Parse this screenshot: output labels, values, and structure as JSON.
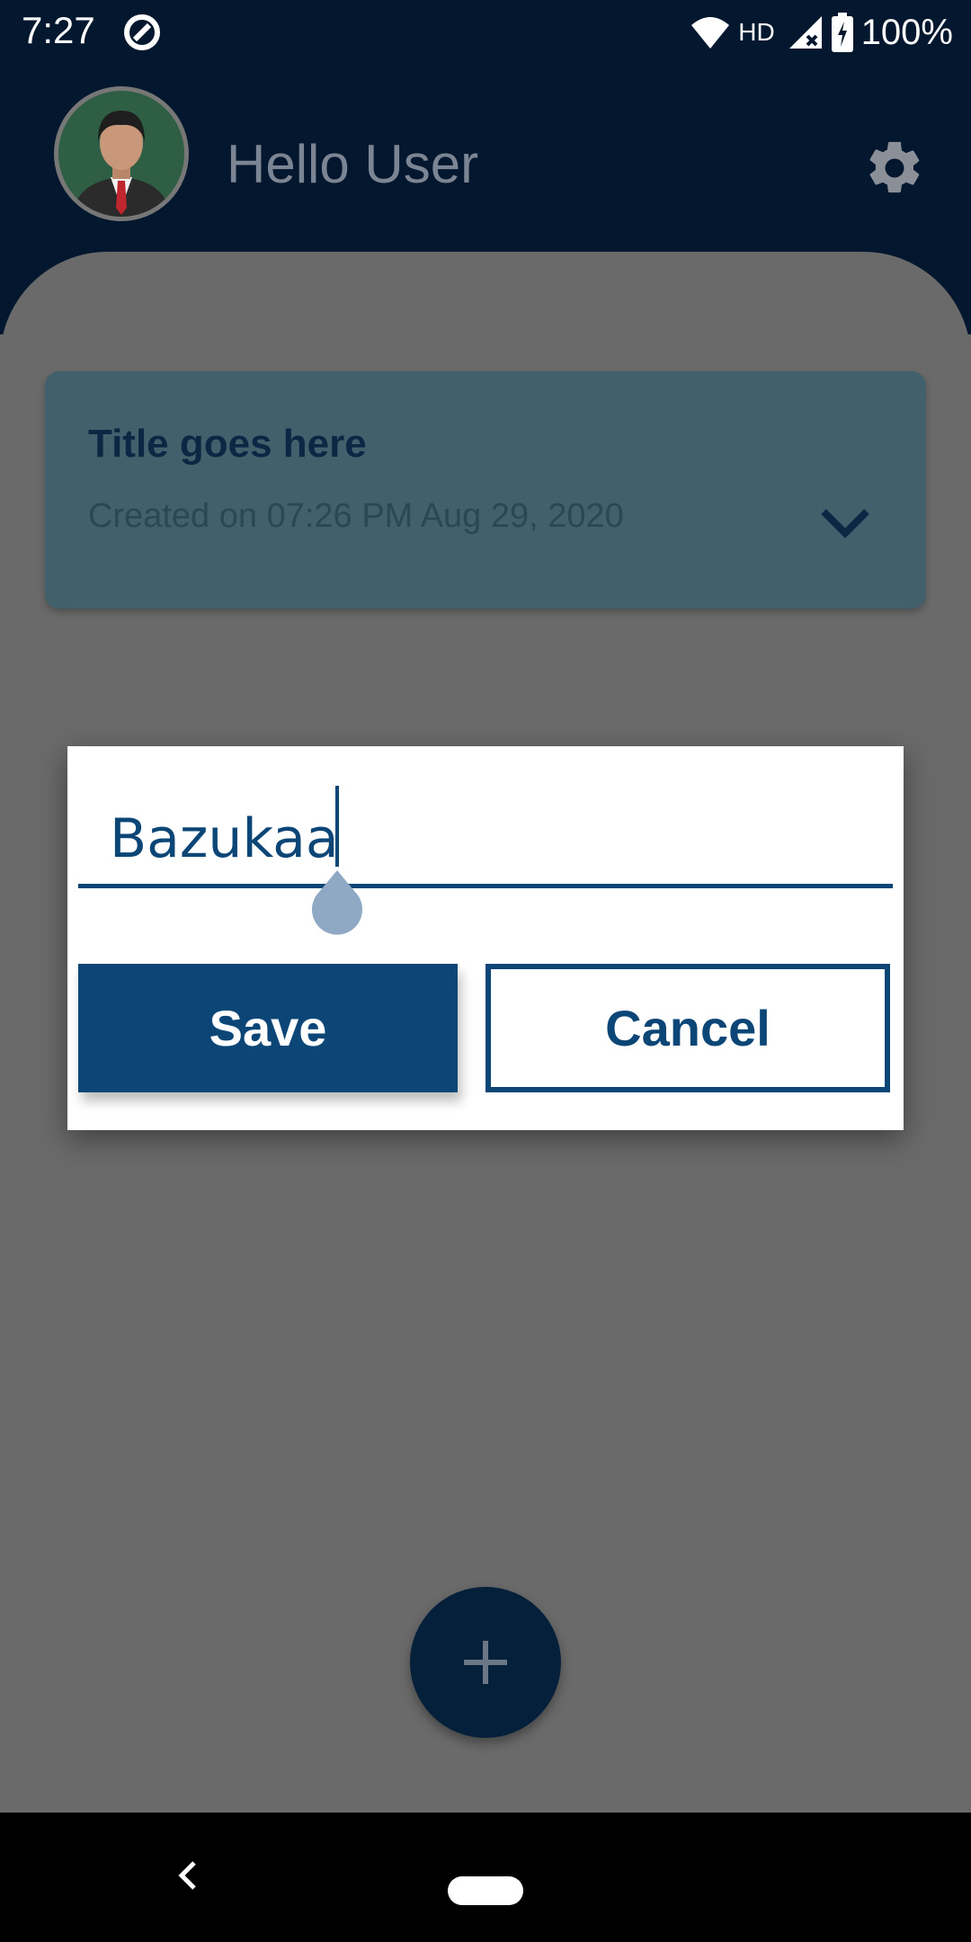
{
  "status_bar": {
    "time": "7:27",
    "network_label": "HD",
    "battery_text": "100%",
    "icons": [
      "q-logo-icon",
      "wifi-icon",
      "signal-icon",
      "battery-icon"
    ]
  },
  "header": {
    "greeting": "Hello User",
    "avatar_icon": "user-avatar",
    "settings_icon": "gear-icon"
  },
  "card": {
    "title": "Title goes here",
    "date": "Created on 07:26 PM Aug 29, 2020",
    "expand_icon": "chevron-down-icon"
  },
  "dialog": {
    "input_value": "Bazukaa",
    "save_label": "Save",
    "cancel_label": "Cancel"
  },
  "fab": {
    "icon": "plus-icon"
  },
  "nav": {
    "back_icon": "back-icon",
    "home_icon": "home-pill"
  },
  "colors": {
    "header_bg": "#03182e",
    "primary": "#0b4677",
    "overlay_bg": "#6a6a6a",
    "card_bg": "#41606c"
  }
}
